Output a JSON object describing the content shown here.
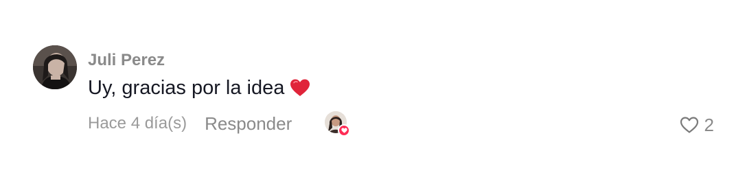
{
  "comment": {
    "username": "Juli Perez",
    "text": "Uy, gracias por la idea",
    "emoji_icon": "red-heart-emoji",
    "timestamp": "Hace 4 día(s)",
    "reply_label": "Responder",
    "creator_liked_icon": "creator-liked-avatar",
    "like_icon": "heart-outline-icon",
    "like_count": "2"
  },
  "colors": {
    "username": "#8a8a8a",
    "text": "#161823",
    "meta": "#9a9a9a",
    "like_badge": "#fe2c55",
    "heart_emoji": "#e0243a"
  }
}
